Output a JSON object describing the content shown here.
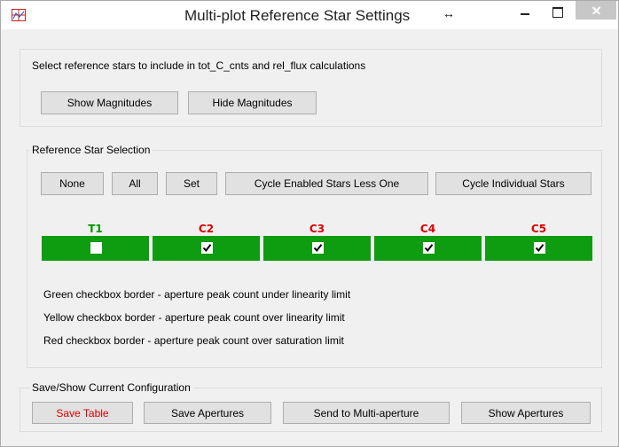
{
  "window": {
    "title": "Multi-plot Reference Star Settings"
  },
  "top": {
    "instruction": "Select reference stars to include in tot_C_cnts and rel_flux calculations",
    "show_magnitudes": "Show Magnitudes",
    "hide_magnitudes": "Hide Magnitudes"
  },
  "selection": {
    "title": "Reference Star Selection",
    "buttons": {
      "none": "None",
      "all": "All",
      "set": "Set",
      "cycle_enabled": "Cycle Enabled Stars Less One",
      "cycle_individual": "Cycle Individual Stars"
    },
    "stars": [
      {
        "label": "T1",
        "color": "#009900",
        "checked": false
      },
      {
        "label": "C2",
        "color": "#dd0000",
        "checked": true
      },
      {
        "label": "C3",
        "color": "#dd0000",
        "checked": true
      },
      {
        "label": "C4",
        "color": "#dd0000",
        "checked": true
      },
      {
        "label": "C5",
        "color": "#dd0000",
        "checked": true
      }
    ],
    "star_bar_color": "#0e9c10",
    "notes": {
      "green": "Green checkbox border - aperture peak count under linearity limit",
      "yellow": "Yellow checkbox border - aperture peak count over linearity limit",
      "red": "Red checkbox border - aperture peak count over saturation limit"
    }
  },
  "config": {
    "title": "Save/Show Current Configuration",
    "save_table": "Save Table",
    "save_apertures": "Save Apertures",
    "send_multi": "Send to Multi-aperture",
    "show_apertures": "Show Apertures"
  }
}
